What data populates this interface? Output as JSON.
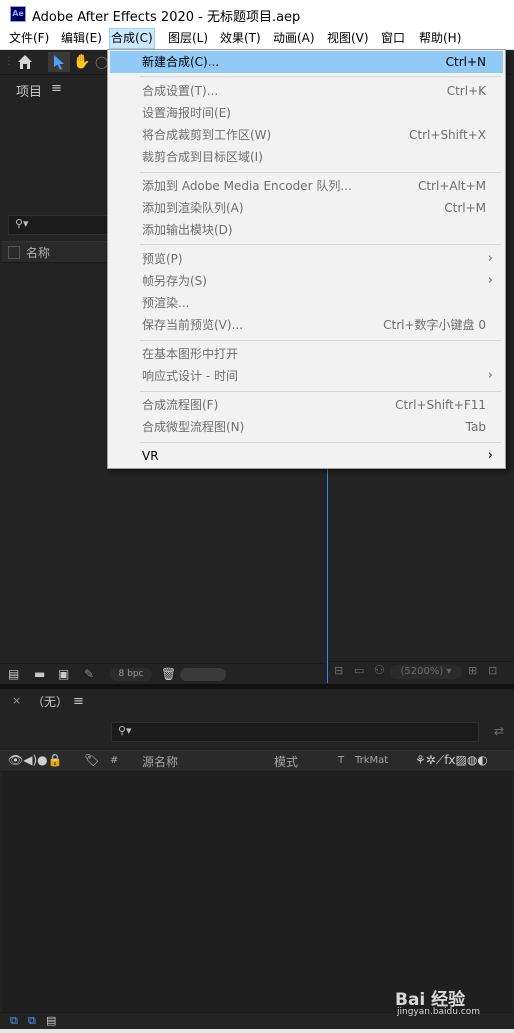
{
  "window": {
    "title": "Adobe After Effects 2020 - 无标题项目.aep",
    "app_icon_text": "Ae"
  },
  "menubar": [
    {
      "label": "文件(F)"
    },
    {
      "label": "编辑(E)"
    },
    {
      "label": "合成(C)"
    },
    {
      "label": "图层(L)"
    },
    {
      "label": "效果(T)"
    },
    {
      "label": "动画(A)"
    },
    {
      "label": "视图(V)"
    },
    {
      "label": "窗口"
    },
    {
      "label": "帮助(H)"
    }
  ],
  "toolbar": {
    "icons": [
      "home-icon",
      "selection-tool-icon",
      "hand-tool-icon"
    ]
  },
  "project": {
    "title": "项目",
    "column_name": "名称",
    "bpc": "8 bpc"
  },
  "viewer": {
    "zoom": "(5200%)"
  },
  "timeline": {
    "tab": "（无）",
    "columns": {
      "hash": "#",
      "source_name": "源名称",
      "mode": "模式",
      "t": "T",
      "trkmat": "TrkMat"
    }
  },
  "dropdown": {
    "items": [
      {
        "label": "新建合成(C)...",
        "shortcut": "Ctrl+N"
      },
      {
        "label": "合成设置(T)...",
        "shortcut": "Ctrl+K"
      },
      {
        "label": "设置海报时间(E)",
        "shortcut": ""
      },
      {
        "label": "将合成裁剪到工作区(W)",
        "shortcut": "Ctrl+Shift+X"
      },
      {
        "label": "裁剪合成到目标区域(I)",
        "shortcut": ""
      },
      {
        "label": "添加到 Adobe Media Encoder 队列...",
        "shortcut": "Ctrl+Alt+M"
      },
      {
        "label": "添加到渲染队列(A)",
        "shortcut": "Ctrl+M"
      },
      {
        "label": "添加输出模块(D)",
        "shortcut": ""
      },
      {
        "label": "预览(P)",
        "shortcut": ""
      },
      {
        "label": "帧另存为(S)",
        "shortcut": ""
      },
      {
        "label": "预渲染...",
        "shortcut": ""
      },
      {
        "label": "保存当前预览(V)...",
        "shortcut": "Ctrl+数字小键盘 0"
      },
      {
        "label": "在基本图形中打开",
        "shortcut": ""
      },
      {
        "label": "响应式设计 - 时间",
        "shortcut": ""
      },
      {
        "label": "合成流程图(F)",
        "shortcut": "Ctrl+Shift+F11"
      },
      {
        "label": "合成微型流程图(N)",
        "shortcut": "Tab"
      },
      {
        "label": "VR",
        "shortcut": ""
      }
    ]
  },
  "watermark": {
    "main": "Bai 经验",
    "sub": "jingyan.baidu.com"
  },
  "colors": {
    "panel_bg": "#232323",
    "menu_bg": "#f2f2f2",
    "highlight": "#91c9f7",
    "viewer_accent": "#2d8ceb"
  }
}
